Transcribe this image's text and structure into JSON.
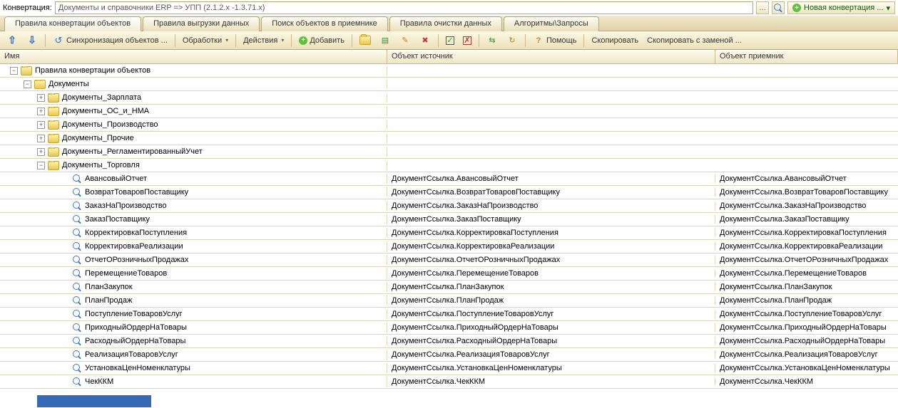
{
  "topbar": {
    "label": "Конвертация:",
    "value": "Документы и справочники ERP => УПП (2.1.2.x -1.3.71.x)",
    "new_btn": "Новая конвертация ..."
  },
  "tabs": [
    "Правила конвертации объектов",
    "Правила выгрузки данных",
    "Поиск объектов в приемнике",
    "Правила очистки данных",
    "Алгоритмы\\Запросы"
  ],
  "toolbar": {
    "sync": "Синхронизация объектов ...",
    "proc": "Обработки",
    "actions": "Действия",
    "add": "Добавить",
    "help": "Помощь",
    "copy": "Скопировать",
    "copy_replace": "Скопировать с заменой ..."
  },
  "columns": {
    "name": "Имя",
    "src": "Объект источник",
    "dst": "Объект приемник"
  },
  "tree": [
    {
      "indent": 14,
      "exp": "-",
      "type": "folder",
      "label": "Правила конвертации объектов",
      "src": "",
      "dst": ""
    },
    {
      "indent": 33,
      "exp": "-",
      "type": "folder",
      "label": "Документы",
      "src": "",
      "dst": ""
    },
    {
      "indent": 52,
      "exp": "+",
      "type": "folder",
      "label": "Документы_Зарплата",
      "src": "",
      "dst": ""
    },
    {
      "indent": 52,
      "exp": "+",
      "type": "folder",
      "label": "Документы_ОС_и_НМА",
      "src": "",
      "dst": ""
    },
    {
      "indent": 52,
      "exp": "+",
      "type": "folder",
      "label": "Документы_Производство",
      "src": "",
      "dst": ""
    },
    {
      "indent": 52,
      "exp": "+",
      "type": "folder",
      "label": "Документы_Прочие",
      "src": "",
      "dst": ""
    },
    {
      "indent": 52,
      "exp": "+",
      "type": "folder",
      "label": "Документы_РегламентированныйУчет",
      "src": "",
      "dst": ""
    },
    {
      "indent": 52,
      "exp": "-",
      "type": "folder",
      "label": "Документы_Торговля",
      "src": "",
      "dst": ""
    },
    {
      "indent": 86,
      "exp": "",
      "type": "item",
      "label": "АвансовыйОтчет",
      "src": "ДокументСсылка.АвансовыйОтчет",
      "dst": "ДокументСсылка.АвансовыйОтчет"
    },
    {
      "indent": 86,
      "exp": "",
      "type": "item",
      "label": "ВозвратТоваровПоставщику",
      "src": "ДокументСсылка.ВозвратТоваровПоставщику",
      "dst": "ДокументСсылка.ВозвратТоваровПоставщику"
    },
    {
      "indent": 86,
      "exp": "",
      "type": "item",
      "label": "ЗаказНаПроизводство",
      "src": "ДокументСсылка.ЗаказНаПроизводство",
      "dst": "ДокументСсылка.ЗаказНаПроизводство"
    },
    {
      "indent": 86,
      "exp": "",
      "type": "item",
      "label": "ЗаказПоставщику",
      "src": "ДокументСсылка.ЗаказПоставщику",
      "dst": "ДокументСсылка.ЗаказПоставщику"
    },
    {
      "indent": 86,
      "exp": "",
      "type": "item",
      "label": "КорректировкаПоступления",
      "src": "ДокументСсылка.КорректировкаПоступления",
      "dst": "ДокументСсылка.КорректировкаПоступления"
    },
    {
      "indent": 86,
      "exp": "",
      "type": "item",
      "label": "КорректировкаРеализации",
      "src": "ДокументСсылка.КорректировкаРеализации",
      "dst": "ДокументСсылка.КорректировкаРеализации"
    },
    {
      "indent": 86,
      "exp": "",
      "type": "item",
      "label": "ОтчетОРозничныхПродажах",
      "src": "ДокументСсылка.ОтчетОРозничныхПродажах",
      "dst": "ДокументСсылка.ОтчетОРозничныхПродажах"
    },
    {
      "indent": 86,
      "exp": "",
      "type": "item",
      "label": "ПеремещениеТоваров",
      "src": "ДокументСсылка.ПеремещениеТоваров",
      "dst": "ДокументСсылка.ПеремещениеТоваров"
    },
    {
      "indent": 86,
      "exp": "",
      "type": "item",
      "label": "ПланЗакупок",
      "src": "ДокументСсылка.ПланЗакупок",
      "dst": "ДокументСсылка.ПланЗакупок"
    },
    {
      "indent": 86,
      "exp": "",
      "type": "item",
      "label": "ПланПродаж",
      "src": "ДокументСсылка.ПланПродаж",
      "dst": "ДокументСсылка.ПланПродаж"
    },
    {
      "indent": 86,
      "exp": "",
      "type": "item",
      "label": "ПоступлениеТоваровУслуг",
      "src": "ДокументСсылка.ПоступлениеТоваровУслуг",
      "dst": "ДокументСсылка.ПоступлениеТоваровУслуг"
    },
    {
      "indent": 86,
      "exp": "",
      "type": "item",
      "label": "ПриходныйОрдерНаТовары",
      "src": "ДокументСсылка.ПриходныйОрдерНаТовары",
      "dst": "ДокументСсылка.ПриходныйОрдерНаТовары"
    },
    {
      "indent": 86,
      "exp": "",
      "type": "item",
      "label": "РасходныйОрдерНаТовары",
      "src": "ДокументСсылка.РасходныйОрдерНаТовары",
      "dst": "ДокументСсылка.РасходныйОрдерНаТовары"
    },
    {
      "indent": 86,
      "exp": "",
      "type": "item",
      "label": "РеализацияТоваровУслуг",
      "src": "ДокументСсылка.РеализацияТоваровУслуг",
      "dst": "ДокументСсылка.РеализацияТоваровУслуг"
    },
    {
      "indent": 86,
      "exp": "",
      "type": "item",
      "label": "УстановкаЦенНоменклатуры",
      "src": "ДокументСсылка.УстановкаЦенНоменклатуры",
      "dst": "ДокументСсылка.УстановкаЦенНоменклатуры"
    },
    {
      "indent": 86,
      "exp": "",
      "type": "item",
      "label": "ЧекККМ",
      "src": "ДокументСсылка.ЧекККМ",
      "dst": "ДокументСсылка.ЧекККМ"
    }
  ]
}
